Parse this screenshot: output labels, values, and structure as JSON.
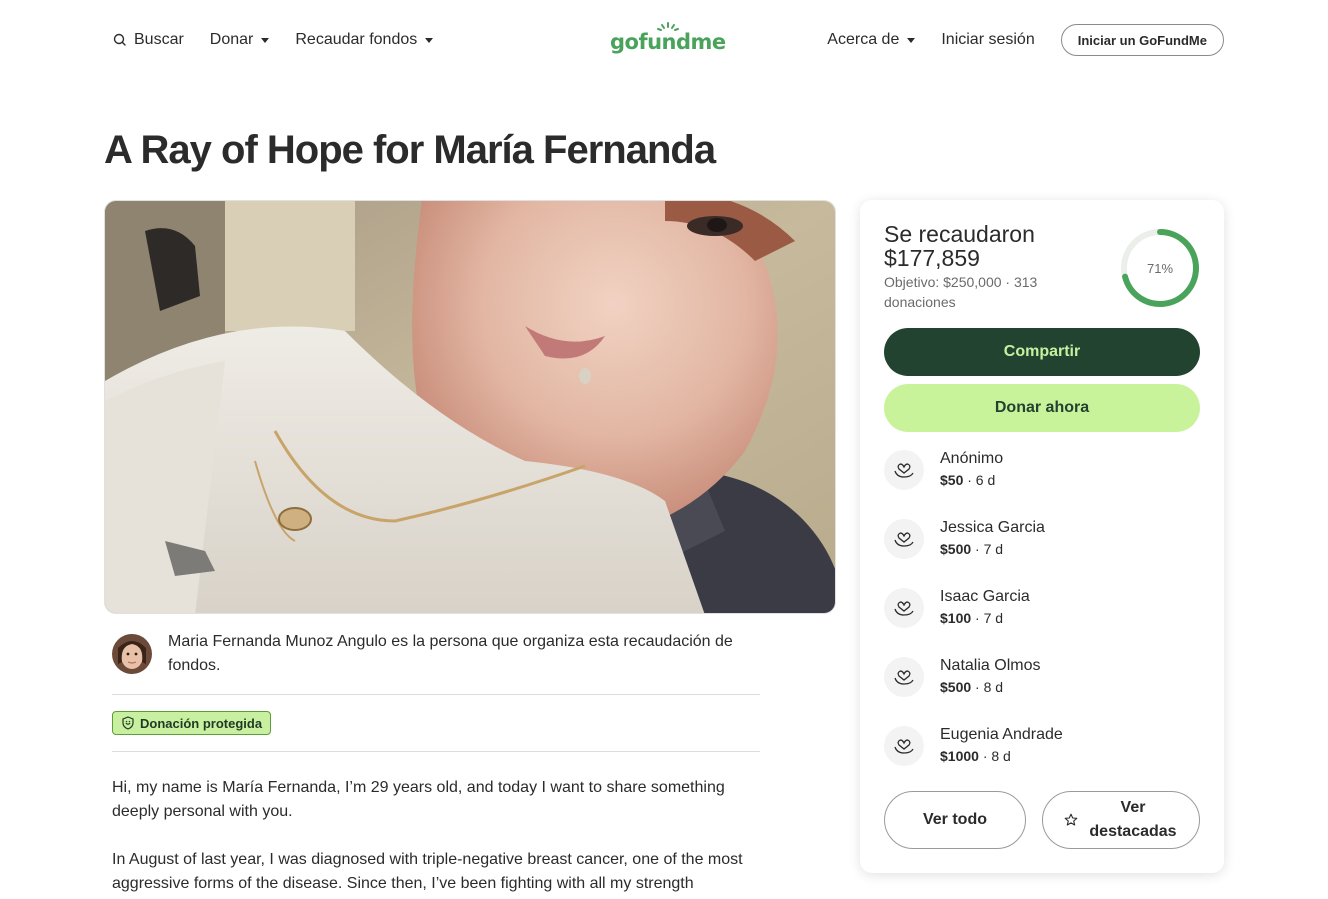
{
  "header": {
    "search_label": "Buscar",
    "donate_label": "Donar",
    "fundraise_label": "Recaudar fondos",
    "logo_text": "gofundme",
    "about_label": "Acerca de",
    "signin_label": "Iniciar sesión",
    "start_label": "Iniciar un GoFundMe"
  },
  "campaign": {
    "title": "A Ray of Hope for María Fernanda",
    "organizer_text": "Maria Fernanda Munoz Angulo es la persona que organiza esta recaudación de fondos.",
    "badge_label": "Donación protegida",
    "story": [
      "Hi, my name is María Fernanda, I’m 29 years old, and today I want to share something deeply personal with you.",
      "In August of last year, I was diagnosed with triple-negative breast cancer, one of the most aggressive forms of the disease. Since then, I’ve been fighting with all my strength"
    ]
  },
  "summary": {
    "raised_label": "Se recaudaron $177,859",
    "goal_text": "Objetivo: $250,000  ·  313 donaciones",
    "progress_label": "71%",
    "progress_fraction": 0.71,
    "share_label": "Compartir",
    "donate_now_label": "Donar ahora",
    "see_all_label": "Ver todo",
    "see_featured_label": "Ver destacadas"
  },
  "donors": [
    {
      "name": "Anónimo",
      "amount": "$50",
      "time": " · 6 d"
    },
    {
      "name": "Jessica Garcia",
      "amount": "$500",
      "time": " · 7 d"
    },
    {
      "name": "Isaac Garcia",
      "amount": "$100",
      "time": " · 7 d"
    },
    {
      "name": "Natalia Olmos",
      "amount": "$500",
      "time": " · 8 d"
    },
    {
      "name": "Eugenia Andrade",
      "amount": "$1000",
      "time": " · 8 d"
    }
  ],
  "colors": {
    "brand_green": "#4aa35a",
    "share_bg": "#234331",
    "donate_bg": "#c8f39a",
    "progress": "#4aa35a"
  }
}
